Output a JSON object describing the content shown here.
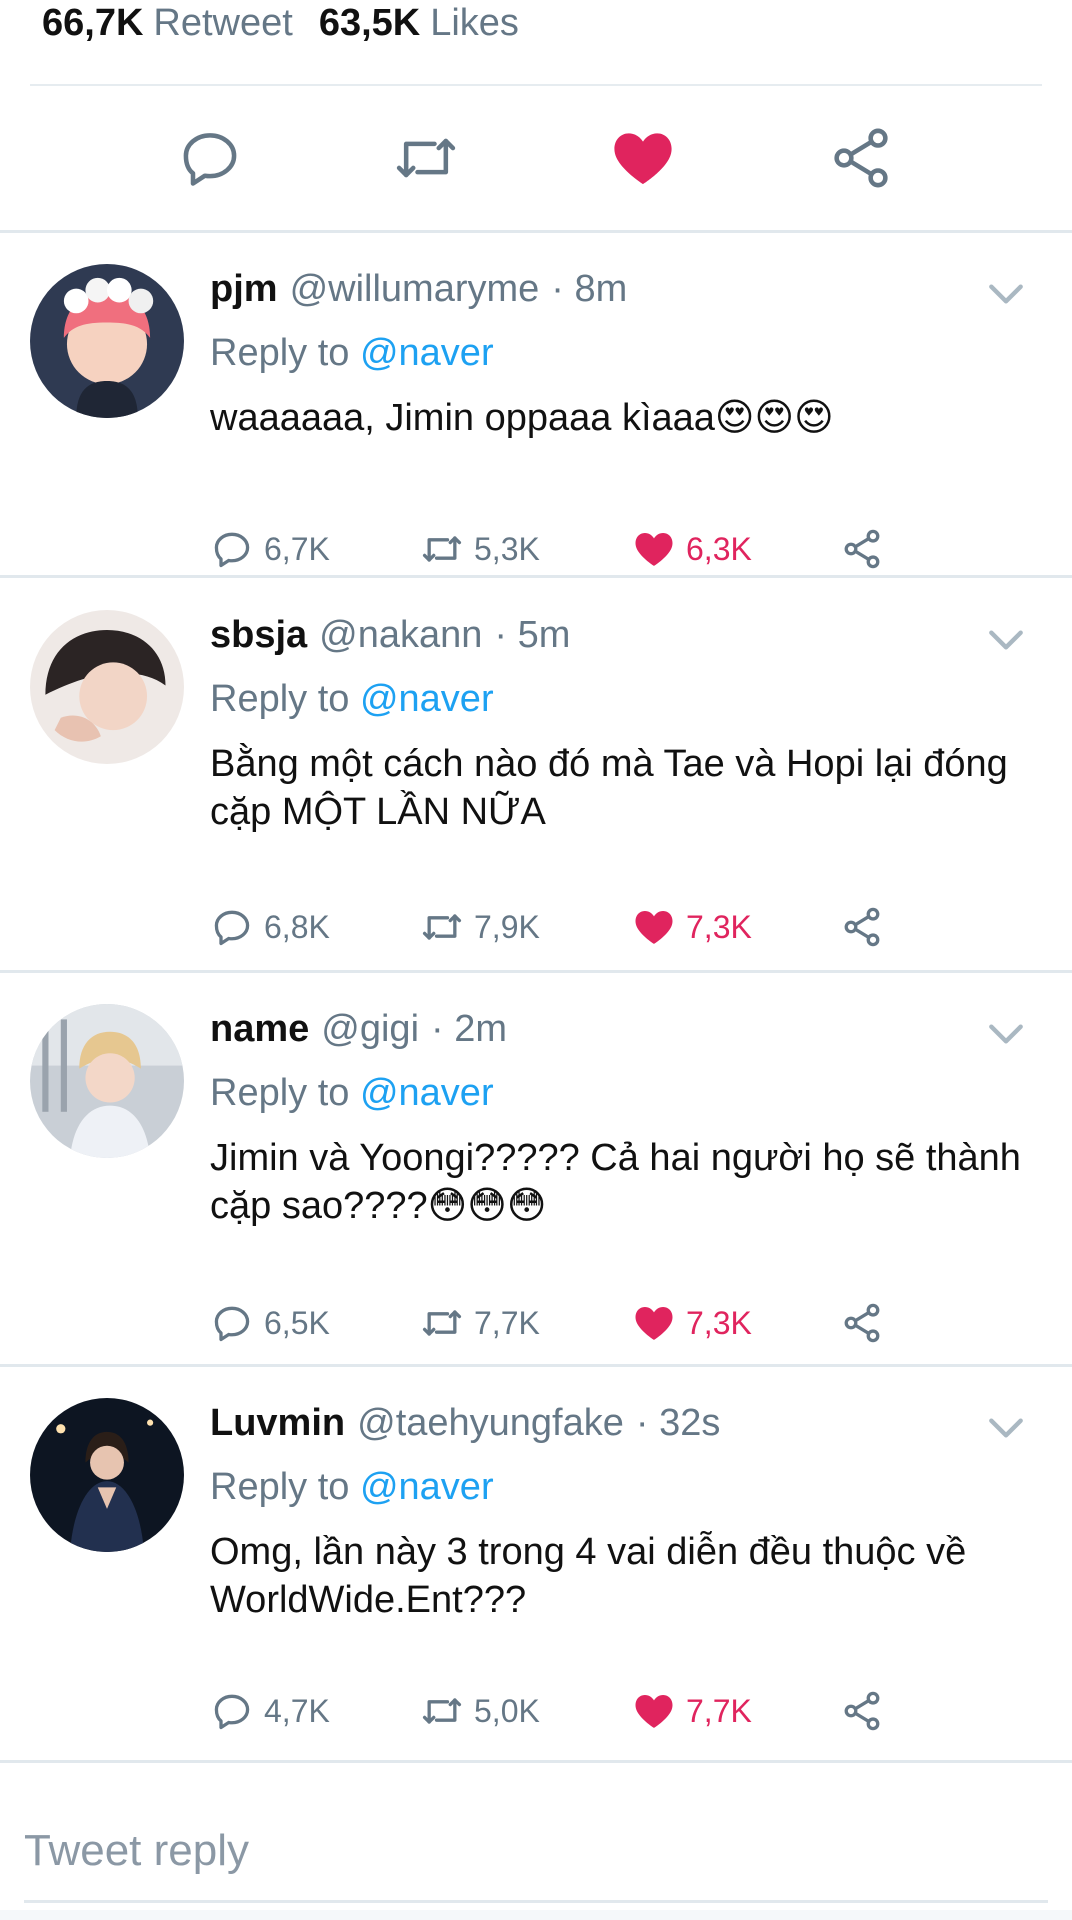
{
  "stats": {
    "retweets_count": "66,7K",
    "retweets_label": "Retweet",
    "likes_count": "63,5K",
    "likes_label": "Likes"
  },
  "main_actions": {
    "icons": [
      "reply-icon",
      "retweet-icon",
      "heart-icon-filled",
      "share-icon"
    ],
    "liked_color": "#e0245e"
  },
  "replies": [
    {
      "name": "pjm",
      "handle": "@willumaryme",
      "time": "· 8m",
      "reply_to_label": "Reply to",
      "reply_to_mention": "@naver",
      "text": "waaaaaa, Jimin oppaaa kìaaa😍😍😍",
      "reply_count": "6,7K",
      "retweet_count": "5,3K",
      "like_count": "6,3K"
    },
    {
      "name": "sbsja",
      "handle": "@nakann",
      "time": "· 5m",
      "reply_to_label": "Reply to",
      "reply_to_mention": "@naver",
      "text": "Bằng một cách nào đó mà Tae và Hopi lại đóng cặp MỘT LẦN NỮA",
      "reply_count": "6,8K",
      "retweet_count": "7,9K",
      "like_count": "7,3K"
    },
    {
      "name": "name",
      "handle": "@gigi",
      "time": "· 2m",
      "reply_to_label": "Reply to",
      "reply_to_mention": "@naver",
      "text": "Jimin và Yoongi????? Cả hai người họ sẽ thành cặp sao????😳😳😳",
      "reply_count": "6,5K",
      "retweet_count": "7,7K",
      "like_count": "7,3K"
    },
    {
      "name": "Luvmin",
      "handle": "@taehyungfake",
      "time": "· 32s",
      "reply_to_label": "Reply to",
      "reply_to_mention": "@naver",
      "text": "Omg, lần này 3 trong 4 vai diễn đều thuộc về WorldWide.Ent???",
      "reply_count": "4,7K",
      "retweet_count": "5,0K",
      "like_count": "7,7K"
    }
  ],
  "reply_box": {
    "placeholder": "Tweet reply"
  },
  "colors": {
    "accent": "#1da1f2",
    "like": "#e0245e",
    "muted": "#657786"
  }
}
